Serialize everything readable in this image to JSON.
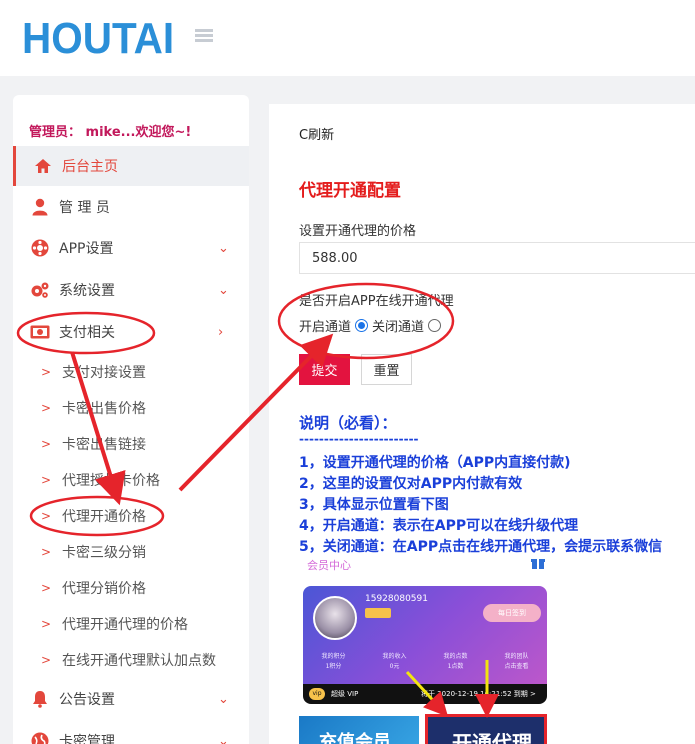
{
  "header": {
    "logo": "HOUTAI",
    "menu_toggle_icon": "hamburger-icon"
  },
  "sidebar": {
    "admin_text": "管理员：  mike...欢迎您~!",
    "items": [
      {
        "label": "后台主页",
        "icon": "home-icon",
        "active": true
      },
      {
        "label": "管 理 员",
        "icon": "user-icon"
      },
      {
        "label": "APP设置",
        "icon": "app-icon",
        "chevron": "chevron-down-icon"
      },
      {
        "label": "系统设置",
        "icon": "gears-icon",
        "chevron": "chevron-down-icon"
      },
      {
        "label": "支付相关",
        "icon": "money-icon",
        "chevron": "chevron-right-icon"
      }
    ],
    "sub_items": [
      {
        "label": "支付对接设置"
      },
      {
        "label": "卡密出售价格"
      },
      {
        "label": "卡密出售链接"
      },
      {
        "label": "代理授权卡价格"
      },
      {
        "label": "代理开通价格"
      },
      {
        "label": "卡密三级分销"
      },
      {
        "label": "代理分销价格"
      },
      {
        "label": "代理开通代理的价格"
      },
      {
        "label": "在线开通代理默认加点数"
      }
    ],
    "bottom_items": [
      {
        "label": "公告设置",
        "icon": "bell-icon",
        "chevron": "chevron-down-icon"
      },
      {
        "label": "卡密管理",
        "icon": "globe-icon",
        "chevron": "chevron-down-icon"
      }
    ]
  },
  "main": {
    "refresh": "C刷新",
    "title": "代理开通配置",
    "price_label": "设置开通代理的价格",
    "price_value": "588.00",
    "open_label": "是否开启APP在线开通代理",
    "radio_on_label": "开启通道",
    "radio_off_label": "关闭通道",
    "radio_selected": "开启通道",
    "submit": "提交",
    "reset": "重置",
    "note_title": "说明（必看）：",
    "note_dash": "------------------------",
    "notes": [
      "1，设置开通代理的价格（APP内直接付款)",
      "2，这里的设置仅对APP内付款有效",
      "3，具体显示位置看下图",
      "4，开启通道：表示在APP可以在线升级代理",
      "5，关闭通道：在APP点击在线开通代理，会提示联系微信"
    ]
  },
  "screenshot": {
    "header": "会员中心",
    "uid": "15928080591",
    "sign_in": "每日签到",
    "stats": [
      "我的积分\n1积分",
      "我的收入\n0元",
      "我的点数\n1点数",
      "我的团队\n点击查看"
    ],
    "vip_label": "超级 VIP",
    "vip_expiry": "将于 2020-12-19 16:21:52 到期 >",
    "tile_left": "充值会员",
    "tile_right": "开通代理"
  },
  "colors": {
    "accent": "#e3473c",
    "logo": "#2b8fd8",
    "note": "#1a3fd9",
    "annotation": "#e5242b"
  }
}
